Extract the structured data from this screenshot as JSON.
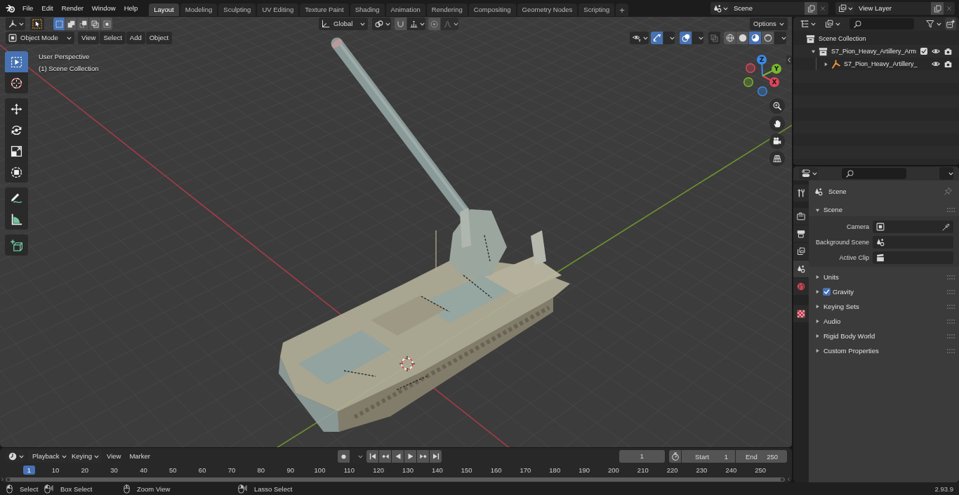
{
  "topbar": {
    "menus": [
      "File",
      "Edit",
      "Render",
      "Window",
      "Help"
    ],
    "workspaces": [
      {
        "label": "Layout",
        "selected": true
      },
      {
        "label": "Modeling",
        "selected": false
      },
      {
        "label": "Sculpting",
        "selected": false
      },
      {
        "label": "UV Editing",
        "selected": false
      },
      {
        "label": "Texture Paint",
        "selected": false
      },
      {
        "label": "Shading",
        "selected": false
      },
      {
        "label": "Animation",
        "selected": false
      },
      {
        "label": "Rendering",
        "selected": false
      },
      {
        "label": "Compositing",
        "selected": false
      },
      {
        "label": "Geometry Nodes",
        "selected": false
      },
      {
        "label": "Scripting",
        "selected": false
      }
    ],
    "add_workspace": "+",
    "scene": "Scene",
    "view_layer": "View Layer"
  },
  "viewport": {
    "tool_header": {
      "select_modes": [
        {
          "kind": "new",
          "selected": true
        },
        {
          "kind": "extend",
          "selected": false
        },
        {
          "kind": "subtract",
          "selected": false
        },
        {
          "kind": "difference",
          "selected": false
        },
        {
          "kind": "intersect",
          "selected": false
        }
      ],
      "orientation": "Global",
      "options": "Options"
    },
    "header": {
      "mode": "Object Mode",
      "menus": [
        "View",
        "Select",
        "Add",
        "Object"
      ],
      "gizmos_on": true,
      "overlays_on": true,
      "shading_modes": [
        {
          "kind": "wireframe",
          "selected": false
        },
        {
          "kind": "solid",
          "selected": false
        },
        {
          "kind": "material",
          "selected": true
        },
        {
          "kind": "rendered",
          "selected": false
        }
      ]
    },
    "tool_groups": [
      [
        {
          "kind": "select-box",
          "selected": true
        },
        {
          "kind": "cursor",
          "selected": false
        }
      ],
      [
        {
          "kind": "move",
          "selected": false
        },
        {
          "kind": "rotate",
          "selected": false
        },
        {
          "kind": "scale",
          "selected": false
        },
        {
          "kind": "transform",
          "selected": false
        }
      ],
      [
        {
          "kind": "annotate",
          "selected": false
        },
        {
          "kind": "measure",
          "selected": false
        }
      ],
      [
        {
          "kind": "add-cube",
          "selected": false
        }
      ]
    ],
    "overlay_text": [
      "User Perspective",
      "(1) Scene Collection"
    ],
    "gizmo_axes": [
      {
        "label": "X",
        "color": "#e0455a"
      },
      {
        "label": "Y",
        "color": "#7ab92b"
      },
      {
        "label": "Z",
        "color": "#3a8ae6"
      }
    ]
  },
  "outliner": {
    "tree": [
      {
        "label": "Scene Collection",
        "kind": "scene",
        "children": [
          {
            "label": "S7_Pion_Heavy_Artillery_Arm",
            "kind": "collection",
            "expanded": true,
            "checked": true,
            "children": [
              {
                "label": "S7_Pion_Heavy_Artillery_",
                "kind": "armature",
                "expanded": false
              }
            ]
          }
        ]
      }
    ]
  },
  "properties": {
    "tab_groups": [
      [
        {
          "kind": "tool",
          "selected": false
        }
      ],
      [
        {
          "kind": "render",
          "selected": false
        },
        {
          "kind": "output",
          "selected": false
        },
        {
          "kind": "view-layer",
          "selected": false
        },
        {
          "kind": "scene",
          "selected": true
        },
        {
          "kind": "world",
          "selected": false
        }
      ],
      [
        {
          "kind": "texture",
          "selected": false
        }
      ]
    ],
    "context": "Scene",
    "panels": [
      {
        "title": "Scene",
        "expanded": true,
        "fields": [
          {
            "label": "Camera",
            "kind": "camera"
          },
          {
            "label": "Background Scene",
            "kind": "scene"
          },
          {
            "label": "Active Clip",
            "kind": "clip"
          }
        ]
      },
      {
        "title": "Units",
        "expanded": false
      },
      {
        "title": "Gravity",
        "expanded": false,
        "checked": true
      },
      {
        "title": "Keying Sets",
        "expanded": false
      },
      {
        "title": "Audio",
        "expanded": false
      },
      {
        "title": "Rigid Body World",
        "expanded": false
      },
      {
        "title": "Custom Properties",
        "expanded": false
      }
    ]
  },
  "timeline": {
    "menus": [
      {
        "label": "Playback",
        "kind": "dropdown"
      },
      {
        "label": "Keying",
        "kind": "dropdown"
      },
      {
        "label": "View",
        "kind": "menu"
      },
      {
        "label": "Marker",
        "kind": "menu"
      }
    ],
    "transport": [
      {
        "kind": "jump-start"
      },
      {
        "kind": "prev-key"
      },
      {
        "kind": "play-reverse"
      },
      {
        "kind": "play"
      },
      {
        "kind": "next-key"
      },
      {
        "kind": "jump-end"
      }
    ],
    "current_frame": "1",
    "start_label": "Start",
    "start": "1",
    "end_label": "End",
    "end": "250",
    "playhead": "1",
    "ruler": [
      "10",
      "20",
      "30",
      "40",
      "50",
      "60",
      "70",
      "80",
      "90",
      "100",
      "110",
      "120",
      "130",
      "140",
      "150",
      "160",
      "170",
      "180",
      "190",
      "200",
      "210",
      "220",
      "230",
      "240",
      "250"
    ]
  },
  "status_bar": {
    "hints": [
      {
        "kind": "left-click",
        "label": "Select"
      },
      {
        "kind": "left-drag",
        "label": "Box Select"
      },
      {
        "kind": "middle-click",
        "label": "Zoom View"
      },
      {
        "kind": "right-drag",
        "label": "Lasso Select"
      }
    ],
    "version": "2.93.9"
  }
}
